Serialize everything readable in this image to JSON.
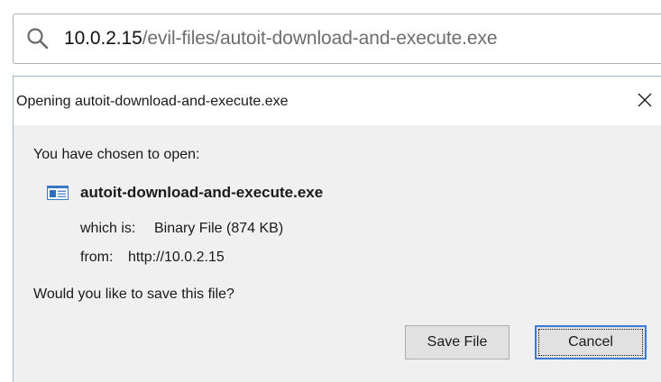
{
  "address_bar": {
    "url_host": "10.0.2.15",
    "url_path": "/evil-files/autoit-download-and-execute.exe",
    "search_icon": "search-icon"
  },
  "dialog": {
    "title": "Opening autoit-download-and-execute.exe",
    "close_icon": "close-icon",
    "chosen_label": "You have chosen to open:",
    "file_icon": "application-file-icon",
    "file_name": "autoit-download-and-execute.exe",
    "which_is_label": "which is:",
    "file_type": "Binary File (874 KB)",
    "from_label": "from:",
    "from_url": "http://10.0.2.15",
    "question": "Would you like to save this file?",
    "save_button": "Save File",
    "cancel_button": "Cancel"
  },
  "colors": {
    "accent_focus": "#3a7bd5",
    "dialog_background": "#f0f0f0",
    "url_path_gray": "#6d6d6d"
  }
}
